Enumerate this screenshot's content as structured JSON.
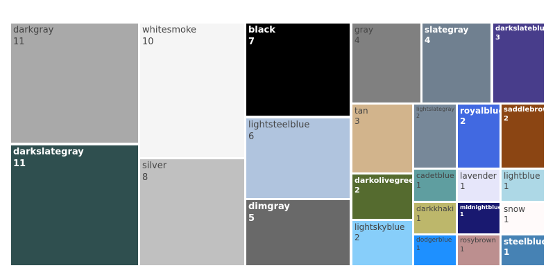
{
  "chart_data": {
    "type": "treemap",
    "title": "",
    "items": [
      {
        "label": "darkgray",
        "value": 11,
        "color": "#a9a9a9"
      },
      {
        "label": "darkslategray",
        "value": 11,
        "color": "#2f4f4f"
      },
      {
        "label": "whitesmoke",
        "value": 10,
        "color": "#f5f5f5"
      },
      {
        "label": "silver",
        "value": 8,
        "color": "#c0c0c0"
      },
      {
        "label": "black",
        "value": 7,
        "color": "#000000"
      },
      {
        "label": "lightsteelblue",
        "value": 6,
        "color": "#b0c4de"
      },
      {
        "label": "dimgray",
        "value": 5,
        "color": "#696969"
      },
      {
        "label": "gray",
        "value": 4,
        "color": "#808080"
      },
      {
        "label": "slategray",
        "value": 4,
        "color": "#708090"
      },
      {
        "label": "darkslateblue",
        "value": 3,
        "color": "#483d8b"
      },
      {
        "label": "tan",
        "value": 3,
        "color": "#d2b48c"
      },
      {
        "label": "darkolivegreen",
        "value": 2,
        "color": "#556b2f"
      },
      {
        "label": "lightskyblue",
        "value": 2,
        "color": "#87cefa"
      },
      {
        "label": "lightslategray",
        "value": 2,
        "color": "#778899"
      },
      {
        "label": "royalblue",
        "value": 2,
        "color": "#4169e1"
      },
      {
        "label": "saddlebrown",
        "value": 2,
        "color": "#8b4513"
      },
      {
        "label": "cadetblue",
        "value": 1,
        "color": "#5f9ea0"
      },
      {
        "label": "lavender",
        "value": 1,
        "color": "#e6e6fa"
      },
      {
        "label": "lightblue",
        "value": 1,
        "color": "#add8e6"
      },
      {
        "label": "darkkhaki",
        "value": 1,
        "color": "#bdb76b"
      },
      {
        "label": "midnightblue",
        "value": 1,
        "color": "#191970"
      },
      {
        "label": "snow",
        "value": 1,
        "color": "#fffafa"
      },
      {
        "label": "dodgerblue",
        "value": 1,
        "color": "#1e90ff"
      },
      {
        "label": "rosybrown",
        "value": 1,
        "color": "#bc8f8f"
      },
      {
        "label": "steelblue",
        "value": 1,
        "color": "#4682b4"
      }
    ]
  }
}
